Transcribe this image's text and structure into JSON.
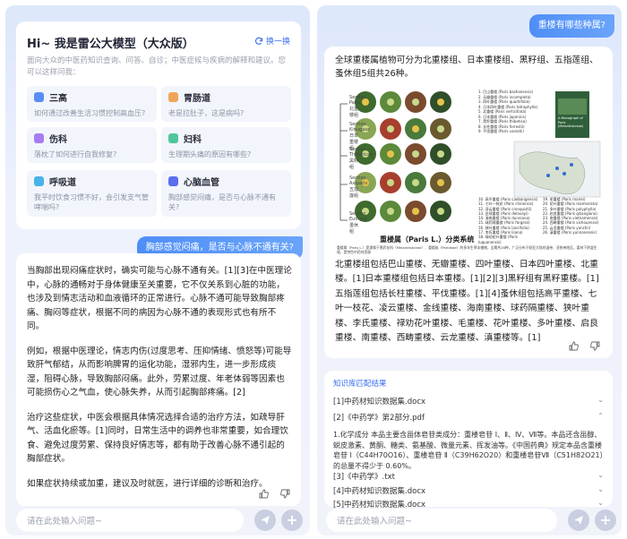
{
  "left": {
    "welcome": {
      "title": "Hi~ 我是雷公大模型（大众版）",
      "refresh": "换一换",
      "subtitle": "面向大众的中医药知识查询、问答、自诊；中医症候与疾病的解释和建议。您可以这样问我：",
      "topics": [
        {
          "name": "三高",
          "q": "如何通过改善生活习惯控制高血压?",
          "color": "#5a8df5"
        },
        {
          "name": "胃肠道",
          "q": "老是拉肚子，这是病吗?",
          "color": "#f0a45a"
        },
        {
          "name": "伤科",
          "q": "落枕了如何进行自我修复?",
          "color": "#a77cf0"
        },
        {
          "name": "妇科",
          "q": "生理期头痛的原因有哪些?",
          "color": "#4fc59a"
        },
        {
          "name": "呼吸道",
          "q": "我平时饮食习惯不好，会引发支气管哮喘吗?",
          "color": "#47b3e8"
        },
        {
          "name": "心脑血管",
          "q": "胸部感觉闷痛，是否与心脉不通有关?",
          "color": "#5a6cf0"
        }
      ]
    },
    "user_message": "胸部感觉闷痛，是否与心脉不通有关?",
    "answer_paragraphs": [
      "当胸部出现闷痛症状时，确实可能与心脉不通有关。[1][3]在中医理论中，心脉的通畅对于身体健康至关重要，它不仅关系到心脏的功能，也涉及到情志活动和血液循环的正常进行。心脉不通可能导致胸部疼痛、胸闷等症状，根据不同的病因为心脉不通的表现形式也有所不同。",
      "例如，根据中医理论，情志内伤(过度思考、压抑情绪、愤怒等)可能导致肝气郁结，从而影响脾胃的运化功能，湿邪内生，进一步形成痰湿，阻碍心脉，导致胸部闷痛。此外，劳累过度、年老体弱等因素也可能损伤心之气血，使心脉失养，从而引起胸部疼痛。[2]",
      "治疗这些症状，中医会根据具体情况选择合适的治疗方法，如疏导肝气、活血化瘀等。[1]同时，日常生活中的调养也非常重要，如合理饮食、避免过度劳累、保持良好情志等，都有助于改善心脉不通引起的胸部症状。",
      "如果症状持续或加重，建议及时就医，进行详细的诊断和治疗。"
    ],
    "input_placeholder": "请在此处输入问题~"
  },
  "right": {
    "user_message": "重楼有哪些种属?",
    "answer_lead": "全球重楼属植物可分为北重楼组、日本重楼组、黑籽组、五指莲组、蚤休组5组共26种。",
    "answer_tail": "北重楼组包括巴山重楼、无瓣重楼、四叶重楼、日本四叶重楼、北重楼。[1]日本重楼组包括日本重楼。[1][2][3]黑籽组有黑籽重楼。[1]五指莲组包括长柱重楼、平伐重楼。[1][4]蚤休组包括高平重楼、七叶一枝花、凌云重楼、金线重楼、海南重楼、球药隔重楼、狭叶重楼、李氏重楼、禄劝花叶重楼、毛重楼、花叶重楼、多叶重楼、启良重楼、南重楼、西畴重楼、云龙重楼、滇重楼等。[1]",
    "figure": {
      "caption": "重楼属（Paris L.）分类系统",
      "book_title": "A Monograph of Paris (Melanthiaceae)",
      "sections": [
        "Section Paris 北重楼组",
        "Section Kinugasa 日本重楼组",
        "Section Thibeticae 黑籽组",
        "Section Axiparis 五指莲组",
        "Section Euthyra 蚤休组"
      ],
      "species_top": [
        "1. 巴山重楼 (Paris bashanensis)",
        "2. 无瓣重楼 (Paris incompleta)",
        "3. 四叶重楼 (Paris quadrifolia)",
        "4. 日本四叶重楼 (Paris tetraphylla)",
        "5. 北重楼 (Paris verticillata)",
        "6. 日本重楼 (Paris japonica)",
        "7. 黑籽重楼 (Paris thibetica)",
        "8. 长柱重楼 (Paris forrestii)",
        "9. 平伐重楼 (Paris vaniotii)"
      ],
      "species_bottom": [
        "10. 高平重楼 (Paris caobangensis)",
        "11. 七叶一枝花 (Paris chinensis)",
        "12. 凌云重楼 (Paris cronquistii)",
        "13. 金线重楼 (Paris delavayi)",
        "14. 海南重楼 (Paris dunniana)",
        "15. 球药隔重楼 (Paris fargesii)",
        "16. 狭叶重楼 (Paris lancifolia)",
        "17. 李氏重楼 (Paris liiana)",
        "18. 禄劝花叶重楼 (Paris luquanensis)",
        "19. 毛重楼 (Paris mairei)",
        "20. 花叶重楼 (Paris marmorata)",
        "21. 多叶重楼 (Paris polyphylla)",
        "22. 启良重楼 (Paris qiliangiana)",
        "23. 南重楼 (Paris vietnamensis)",
        "24. 西畴重楼 (Paris xichouensis)",
        "25. 云龙重楼 (Paris yanchii)",
        "26. 滇重楼 (Paris yunnanensis)"
      ],
      "source_note": "重楼属（Paris L.）是隶属于黑药花科（Melanthiaceae）、重楼族（Parideae）的多年生草本植物，全属共26种，广泛分布于欧亚大陆的温带、亚热带地区，喜林下阴湿生境，是特色中药材资源"
    },
    "kb": {
      "title": "知识库匹配结果",
      "rows": [
        {
          "label": "[1]中药材知识数据集.docx",
          "chev": "⌄"
        },
        {
          "label": "[2]《中药学》第2部分.pdf",
          "chev": "⌃"
        },
        {
          "label": "[3]《中药学》.txt",
          "chev": "⌄"
        },
        {
          "label": "[4]中药材知识数据集.docx",
          "chev": "⌄"
        },
        {
          "label": "[5]中药材知识数据集.docx",
          "chev": "⌄"
        }
      ],
      "excerpt": "1.化学成分 本品主要含甾体皂苷类成分：重楼皂苷 Ⅰ、Ⅱ、Ⅳ、Ⅶ等。本品还含甾醇、蜕皮激素、黄酮、糖类、氨基酸、微量元素、挥发油等。《中国药典》规定本品含重楼皂苷 Ⅰ（C44H70O16）、重楼皂苷 Ⅱ（C39H62O20）和重楼皂苷Ⅶ（C51H82O21）的总量不得少于 0.60%。"
    },
    "input_placeholder": "请在此处输入问题~"
  },
  "colors": {
    "accent": "#3a6ff0",
    "bubble": "#4e8ef7",
    "panel_bg": "#e6ecfb"
  },
  "icons": {
    "refresh": "refresh-icon",
    "like": "thumbs-up-icon",
    "dislike": "thumbs-down-icon",
    "send": "send-icon",
    "add": "plus-icon"
  }
}
